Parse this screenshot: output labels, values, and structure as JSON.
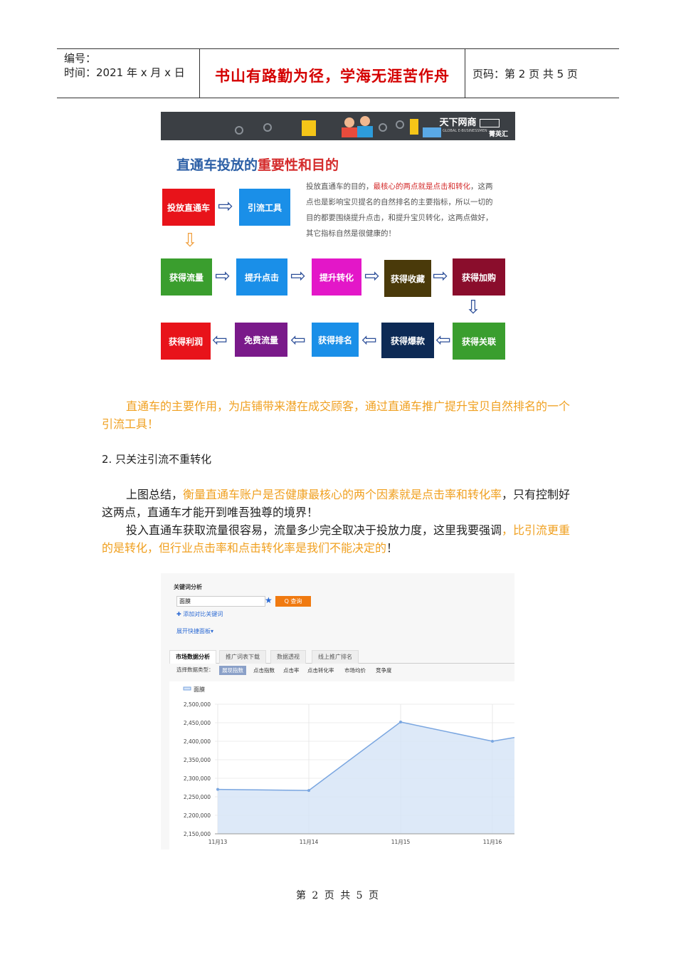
{
  "header": {
    "code_label": "编号：",
    "time_label": "时间：2021 年 x 月 x 日",
    "motto": "书山有路勤为径，学海无涯苦作舟",
    "page_info": "页码：第 2 页  共 5 页"
  },
  "infographic": {
    "brand_main": "天下网商",
    "brand_sub": "菁英汇",
    "brand_en": "GLOBAL E-BUSINESSMEN",
    "title_normal": "直通车投放的",
    "title_emph": "重要性和目的",
    "desc_pre": "投放直通车的目的，",
    "desc_red": "最核心的两点就是点击和转化",
    "desc_post": "，这两点也是影响宝贝提名的自然排名的主要指标，所以一切的目的都要围绕提升点击，和提升宝贝转化，这两点做好，其它指标自然是很健康的！",
    "boxes": {
      "b1": "投放直通车",
      "b2": "引流工具",
      "b3": "获得流量",
      "b4": "提升点击",
      "b5": "提升转化",
      "b6": "获得收藏",
      "b7": "获得加购",
      "b8": "获得关联",
      "b9": "获得爆款",
      "b10": "获得排名",
      "b11": "免费流量",
      "b12": "获得利润"
    },
    "colors": {
      "red": "#e8131a",
      "blue": "#1a8fe8",
      "green": "#3a9e2e",
      "magenta": "#e317c8",
      "olive": "#4a3a0a",
      "maroon": "#8a0d2c",
      "navy": "#0d2a55",
      "purple": "#7a1a8a"
    }
  },
  "para1": {
    "text": "直通车的主要作用，为店铺带来潜在成交顾客，通过直通车推广提升宝贝自然排名的一个引流工具！"
  },
  "section2": {
    "title": "2. 只关注引流不重转化"
  },
  "para2": {
    "pre": "上图总结，",
    "orange": "衡量直通车账户是否健康最核心的两个因素就是点击率和转化率",
    "post": "，只有控制好这两点，直通车才能开到唯吾独尊的境界！"
  },
  "para3": {
    "pre": "投入直通车获取流量很容易，流量多少完全取决于投放力度，这里我要强调",
    "orange": "，比引流更重的是转化，但行业点击率和点击转化率是我们不能决定的",
    "post": "！"
  },
  "screenshot": {
    "panel_title": "关键词分析",
    "search_value": "面膜",
    "query_button": "Q 查询",
    "add_compare": "✚ 添加对比关键词",
    "expand": "展开快捷面板▾",
    "tabs": [
      "市场数据分析",
      "推广词表下载",
      "数据透视",
      "线上推广排名"
    ],
    "select_label": "选择数据类型：",
    "chips": [
      "展现指数",
      "点击指数",
      "点击率",
      "点击转化率",
      "市场均价",
      "竞争度"
    ],
    "legend": "面膜"
  },
  "chart_data": {
    "type": "area",
    "x": [
      "11月13",
      "11月14",
      "11月15",
      "11月16",
      ""
    ],
    "series": [
      {
        "name": "面膜",
        "values": [
          2270000,
          2267000,
          2452000,
          2400000,
          2410000
        ]
      }
    ],
    "yticks": [
      "2,500,000",
      "2,450,000",
      "2,400,000",
      "2,350,000",
      "2,300,000",
      "2,250,000",
      "2,200,000",
      "2,150,000"
    ],
    "ylim": [
      2150000,
      2500000
    ],
    "grid": true,
    "line_color": "#7aa6e0",
    "fill_color": "#d5e3f6"
  },
  "footer": {
    "text": "第 2 页 共 5 页"
  }
}
